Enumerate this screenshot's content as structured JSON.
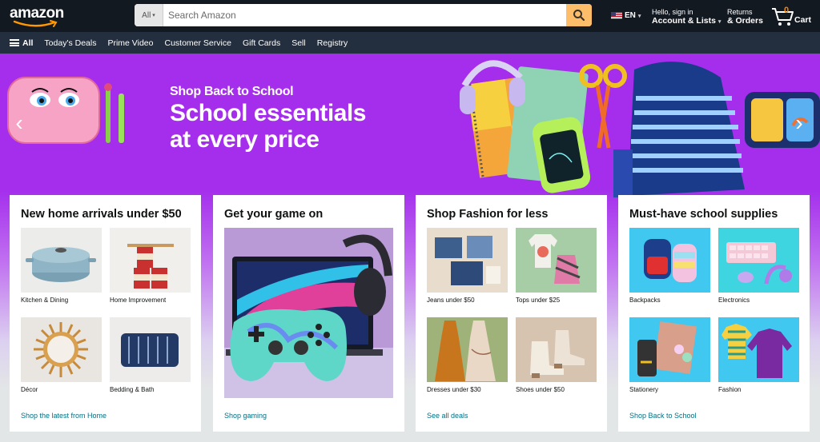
{
  "header": {
    "logo_text": "amazon",
    "search": {
      "category": "All",
      "placeholder": "Search Amazon"
    },
    "language": "EN",
    "account": {
      "line1": "Hello, sign in",
      "line2": "Account & Lists"
    },
    "returns": {
      "line1": "Returns",
      "line2": "& Orders"
    },
    "cart": {
      "count": "0",
      "label": "Cart"
    }
  },
  "subnav": {
    "all_label": "All",
    "items": [
      "Today's Deals",
      "Prime Video",
      "Customer Service",
      "Gift Cards",
      "Sell",
      "Registry"
    ]
  },
  "hero": {
    "kicker": "Shop Back to School",
    "title_line1": "School essentials",
    "title_line2": "at every price"
  },
  "cards": [
    {
      "title": "New home arrivals under $50",
      "tiles": [
        "Kitchen & Dining",
        "Home Improvement",
        "Décor",
        "Bedding & Bath"
      ],
      "link": "Shop the latest from Home"
    },
    {
      "title": "Get your game on",
      "link": "Shop gaming"
    },
    {
      "title": "Shop Fashion for less",
      "tiles": [
        "Jeans under $50",
        "Tops under $25",
        "Dresses under $30",
        "Shoes under $50"
      ],
      "link": "See all deals"
    },
    {
      "title": "Must-have school supplies",
      "tiles": [
        "Backpacks",
        "Electronics",
        "Stationery",
        "Fashion"
      ],
      "link": "Shop Back to School"
    }
  ],
  "colors": {
    "nav_dark": "#131921",
    "nav_sub": "#232f3e",
    "search_button": "#febd69",
    "hero_purple": "#a42eec",
    "link": "#007185",
    "cart_count": "#f08804"
  },
  "icons": [
    "amazon-smile-logo",
    "search-icon",
    "us-flag-icon",
    "cart-icon",
    "hamburger-icon",
    "chevron-left-icon",
    "chevron-right-icon"
  ]
}
